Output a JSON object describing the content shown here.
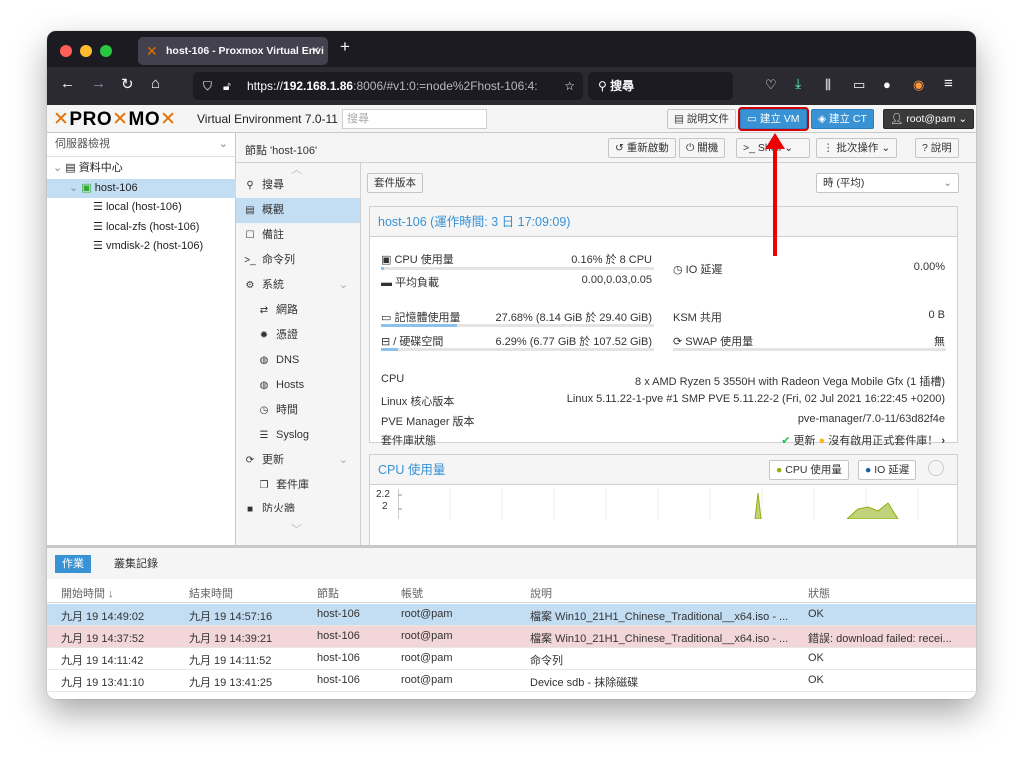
{
  "browser": {
    "tab_title": "host-106 - Proxmox Virtual Envi",
    "url_prefix": "https://",
    "url_host": "192.168.1.86",
    "url_rest": ":8006/#v1:0:=node%2Fhost-106:4:",
    "search_label": "搜尋"
  },
  "header": {
    "logo_left": "PRO",
    "logo_mid": "MO",
    "version": "Virtual Environment 7.0-11",
    "search_placeholder": "搜尋",
    "docs_label": "說明文件",
    "create_vm_label": "建立 VM",
    "create_ct_label": "建立 CT",
    "user_label": "root@pam"
  },
  "sidebar": {
    "view_selector": "伺服器檢視",
    "items": [
      {
        "label": "資料中心"
      },
      {
        "label": "host-106"
      },
      {
        "label": "local (host-106)"
      },
      {
        "label": "local-zfs (host-106)"
      },
      {
        "label": "vmdisk-2 (host-106)"
      }
    ]
  },
  "node": {
    "title": "節點 'host-106'",
    "toolbar": {
      "reboot": "重新啟動",
      "shutdown": "關機",
      "shell": "Shell",
      "bulk": "批次操作",
      "help": "說明"
    },
    "nav": [
      {
        "label": "搜尋"
      },
      {
        "label": "概觀"
      },
      {
        "label": "備註"
      },
      {
        "label": "命令列"
      },
      {
        "label": "系統"
      },
      {
        "label": "網路"
      },
      {
        "label": "憑證"
      },
      {
        "label": "DNS"
      },
      {
        "label": "Hosts"
      },
      {
        "label": "時間"
      },
      {
        "label": "Syslog"
      },
      {
        "label": "更新"
      },
      {
        "label": "套件庫"
      },
      {
        "label": "防火牆"
      }
    ],
    "package_versions_btn": "套件版本",
    "timeframe": "時 (平均)"
  },
  "summary": {
    "title": "host-106 (運作時間: 3 日 17:09:09)",
    "cpu_label": "CPU 使用量",
    "cpu_value": "0.16% 於 8 CPU",
    "cpu_usage": 0.0016,
    "io_label": "IO 延遲",
    "io_value": "0.00%",
    "load_label": "平均負載",
    "load_value": "0.00,0.03,0.05",
    "mem_label": "記憶體使用量",
    "mem_value": "27.68% (8.14 GiB 於 29.40 GiB)",
    "mem_usage": 0.2768,
    "ksm_label": "KSM 共用",
    "ksm_value": "0 B",
    "disk_label": "/ 硬碟空間",
    "disk_value": "6.29% (6.77 GiB 於 107.52 GiB)",
    "disk_usage": 0.0629,
    "swap_label": "SWAP 使用量",
    "swap_value": "無",
    "cpu_model_label": "CPU",
    "cpu_model_value": "8 x AMD Ryzen 5 3550H with Radeon Vega Mobile Gfx (1 插槽)",
    "kernel_label": "Linux 核心版本",
    "kernel_value": "Linux 5.11.22-1-pve #1 SMP PVE 5.11.22-2 (Fri, 02 Jul 2021 16:22:45 +0200)",
    "pve_label": "PVE Manager 版本",
    "pve_value": "pve-manager/7.0-11/63d82f4e",
    "repo_label": "套件庫狀態",
    "repo_update": "更新",
    "repo_warning": "沒有啟用正式套件庫！"
  },
  "cpu_chart": {
    "title": "CPU 使用量",
    "legend_cpu": "CPU 使用量",
    "legend_io": "IO 延遲",
    "ticks": [
      "2.2",
      "2"
    ]
  },
  "tasks": {
    "tab_tasks": "作業",
    "tab_cluster_log": "叢集記錄",
    "headers": {
      "start": "開始時間 ↓",
      "end": "結束時間",
      "node": "節點",
      "user": "帳號",
      "desc": "說明",
      "status": "狀態"
    },
    "rows": [
      {
        "start": "九月 19 14:49:02",
        "end": "九月 19 14:57:16",
        "node": "host-106",
        "user": "root@pam",
        "desc": "檔案 Win10_21H1_Chinese_Traditional__x64.iso - ...",
        "status": "OK"
      },
      {
        "start": "九月 19 14:37:52",
        "end": "九月 19 14:39:21",
        "node": "host-106",
        "user": "root@pam",
        "desc": "檔案 Win10_21H1_Chinese_Traditional__x64.iso - ...",
        "status": "錯誤: download failed: recei..."
      },
      {
        "start": "九月 19 14:11:42",
        "end": "九月 19 14:11:52",
        "node": "host-106",
        "user": "root@pam",
        "desc": "命令列",
        "status": "OK"
      },
      {
        "start": "九月 19 13:41:10",
        "end": "九月 19 13:41:25",
        "node": "host-106",
        "user": "root@pam",
        "desc": "Device sdb - 抹除磁碟",
        "status": "OK"
      }
    ]
  },
  "colors": {
    "accent": "#3892d4",
    "proxmox_orange": "#e57000",
    "selected": "#c3ddf3",
    "error_row": "#f3d6d7",
    "annotation_arrow": "#e00000"
  }
}
